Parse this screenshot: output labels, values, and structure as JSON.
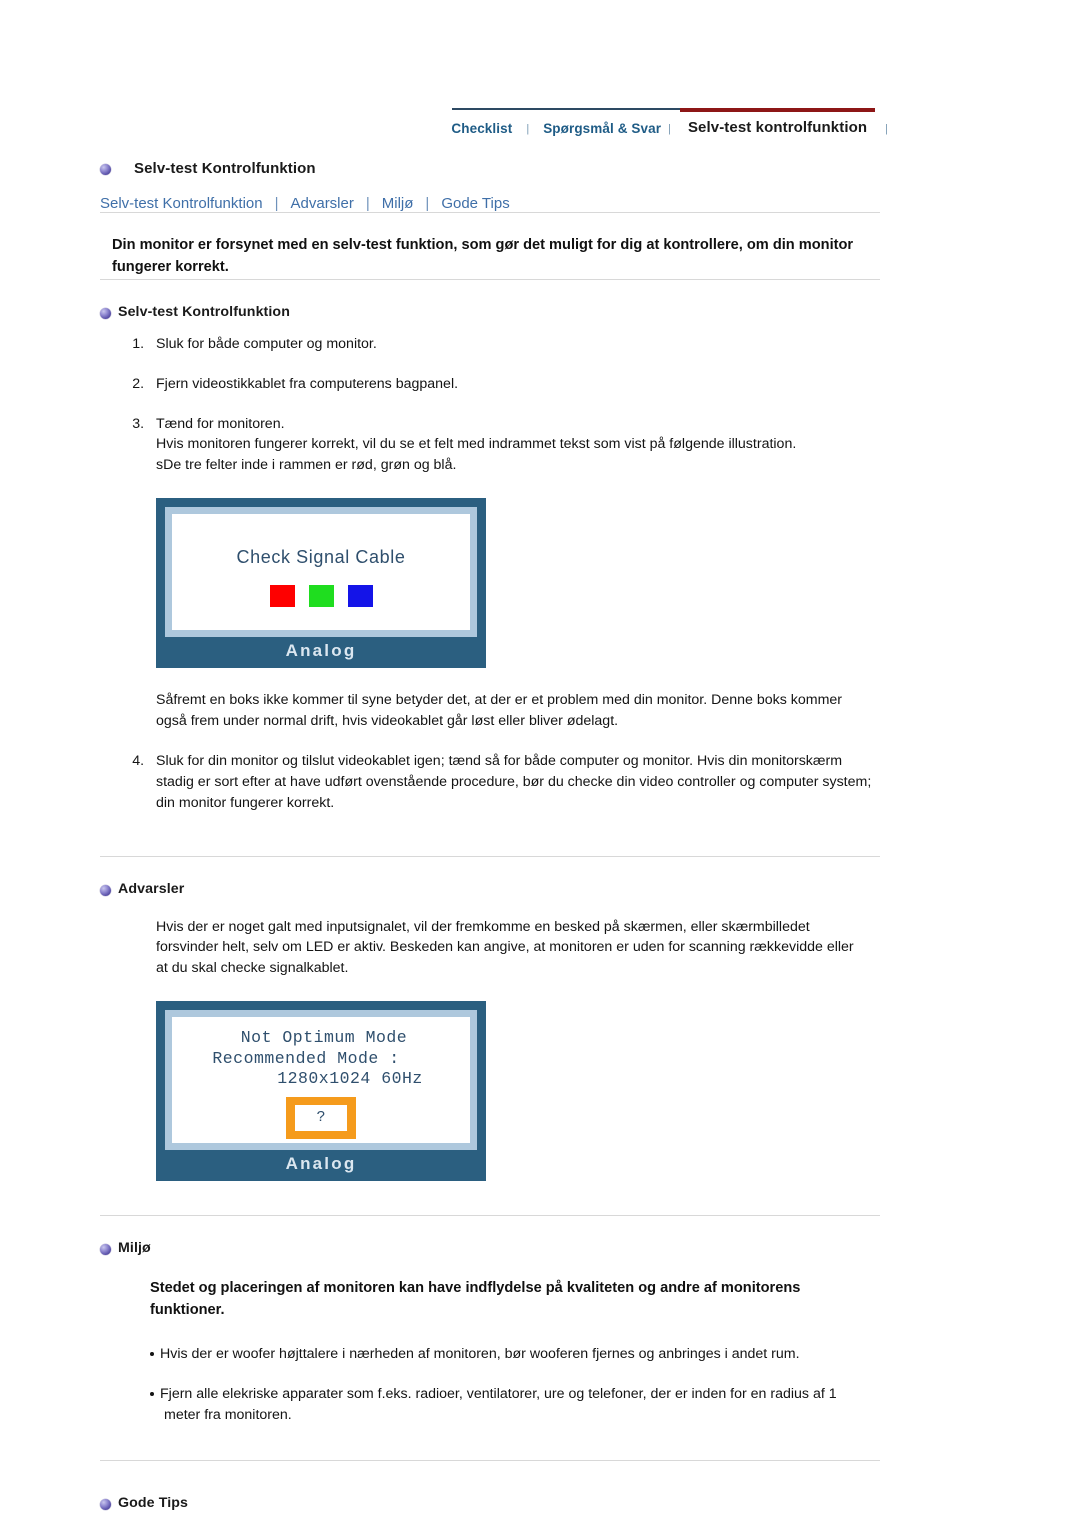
{
  "topnav": {
    "tabs": [
      {
        "label": "Checklist",
        "active": false
      },
      {
        "label": "Spørgsmål & Svar",
        "active": false
      },
      {
        "label": "Selv-test kontrolfunktion",
        "active": true
      }
    ],
    "separator": "|",
    "active_underline_color": "#8d1616",
    "link_color": "#1f5c86"
  },
  "page": {
    "title": "Selv-test Kontrolfunktion",
    "bullet_icon": "sphere-bullet-icon"
  },
  "subnav": {
    "links": [
      "Selv-test Kontrolfunktion",
      "Advarsler",
      "Miljø",
      "Gode Tips"
    ],
    "separator": "|",
    "link_color": "#3f6fa8"
  },
  "intro": "Din monitor er forsynet med en selv-test funktion, som gør det muligt for dig at kontrollere, om din monitor fungerer korrekt.",
  "sections": {
    "selftest": {
      "heading": "Selv-test Kontrolfunktion",
      "steps": [
        {
          "n": "1.",
          "text": "Sluk for både computer og monitor."
        },
        {
          "n": "2.",
          "text": "Fjern videostikkablet fra computerens bagpanel."
        },
        {
          "n": "3.",
          "text": "Tænd for monitoren.",
          "line2": "Hvis monitoren fungerer korrekt, vil du se et felt med indrammet tekst som vist på følgende illustration.",
          "line3": "sDe tre felter inde i rammen er rød, grøn og blå."
        },
        {
          "n": "4.",
          "text": "Sluk for din monitor og tilslut videokablet igen; tænd så for både computer og monitor. Hvis din monitorskærm stadig er sort efter at have udført ovenstående procedure, bør du checke din video controller og computer system; din monitor fungerer korrekt."
        }
      ],
      "after_image_paragraph": "Såfremt en boks ikke kommer til syne betyder det, at der er et problem med din monitor. Denne boks kommer også frem under normal drift, hvis videokablet går løst eller bliver ødelagt."
    },
    "advarsler": {
      "heading": "Advarsler",
      "paragraph": "Hvis der er noget galt med inputsignalet, vil der fremkomme en besked på skærmen, eller skærmbilledet forsvinder helt, selv om LED er aktiv. Beskeden kan angive, at monitoren er uden for scanning rækkevidde eller at du skal checke signalkablet."
    },
    "miljo": {
      "heading": "Miljø",
      "bold_paragraph": "Stedet og placeringen af monitoren kan have indflydelse på kvaliteten og andre af monitorens funktioner.",
      "bullets": [
        "Hvis der er woofer højttalere i nærheden af monitoren, bør wooferen fjernes og anbringes i andet rum.",
        "Fjern alle elekriske apparater som f.eks. radioer, ventilatorer, ure og telefoner, der er inden for en radius af 1 meter fra monitoren."
      ]
    },
    "godetips": {
      "heading": "Gode Tips"
    }
  },
  "illustrations": {
    "monitor1": {
      "message": "Check Signal Cable",
      "squares": [
        {
          "name": "red-square",
          "color": "#fe0000"
        },
        {
          "name": "green-square",
          "color": "#1fdd1f"
        },
        {
          "name": "blue-square",
          "color": "#1414e8"
        }
      ],
      "label": "Analog",
      "frame_color": "#2b5f80",
      "bezel_color": "#aec8dd"
    },
    "monitor2": {
      "line1": "Not Optimum Mode",
      "line2": "Recommended Mode :",
      "line3": "1280x1024 60Hz",
      "question_mark": "?",
      "box_color": "#f59b1c",
      "label": "Analog",
      "frame_color": "#2b5f80",
      "bezel_color": "#aec8dd"
    }
  }
}
